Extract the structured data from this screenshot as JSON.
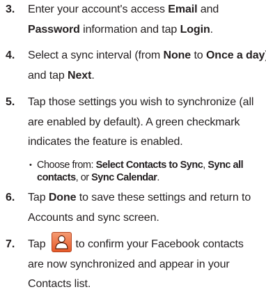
{
  "steps": [
    {
      "number": "3.",
      "lines": [
        [
          {
            "t": "Enter your account's access "
          },
          {
            "t": "Email",
            "b": true
          },
          {
            "t": " and"
          }
        ],
        [
          {
            "t": "Password",
            "b": true
          },
          {
            "t": " information and tap "
          },
          {
            "t": "Login",
            "b": true
          },
          {
            "t": "."
          }
        ]
      ]
    },
    {
      "number": "4.",
      "lines": [
        [
          {
            "t": "Select a sync interval (from "
          },
          {
            "t": "None",
            "b": true
          },
          {
            "t": " to "
          },
          {
            "t": "Once a day",
            "b": true
          },
          {
            "t": ")"
          }
        ],
        [
          {
            "t": "and tap "
          },
          {
            "t": "Next",
            "b": true
          },
          {
            "t": "."
          }
        ]
      ]
    },
    {
      "number": "5.",
      "lines": [
        [
          {
            "t": "Tap those settings you wish to synchronize (all"
          }
        ],
        [
          {
            "t": "are enabled by default). A green checkmark"
          }
        ],
        [
          {
            "t": "indicates the feature is enabled."
          }
        ]
      ],
      "sub": {
        "bullet": "•",
        "lines": [
          [
            {
              "t": "Choose from: "
            },
            {
              "t": "Select Contacts to Sync",
              "b": true
            },
            {
              "t": ", "
            },
            {
              "t": "Sync all",
              "b": true
            }
          ],
          [
            {
              "t": "contacts",
              "b": true
            },
            {
              "t": ", or "
            },
            {
              "t": "Sync Calendar",
              "b": true
            },
            {
              "t": "."
            }
          ]
        ]
      }
    },
    {
      "number": "6.",
      "lines": [
        [
          {
            "t": "Tap "
          },
          {
            "t": "Done",
            "b": true
          },
          {
            "t": " to save these settings and return to"
          }
        ],
        [
          {
            "t": "Accounts and sync screen."
          }
        ]
      ]
    },
    {
      "number": "7.",
      "lines": [
        [
          {
            "t": "Tap"
          },
          {
            "icon": "contacts-icon"
          },
          {
            "t": "to confirm your Facebook contacts"
          }
        ],
        [
          {
            "t": "are now synchronized and appear in your"
          }
        ],
        [
          {
            "t": "Contacts list."
          }
        ]
      ]
    }
  ],
  "colors": {
    "text": "#231f20",
    "contacts_icon": "#e8683a"
  }
}
